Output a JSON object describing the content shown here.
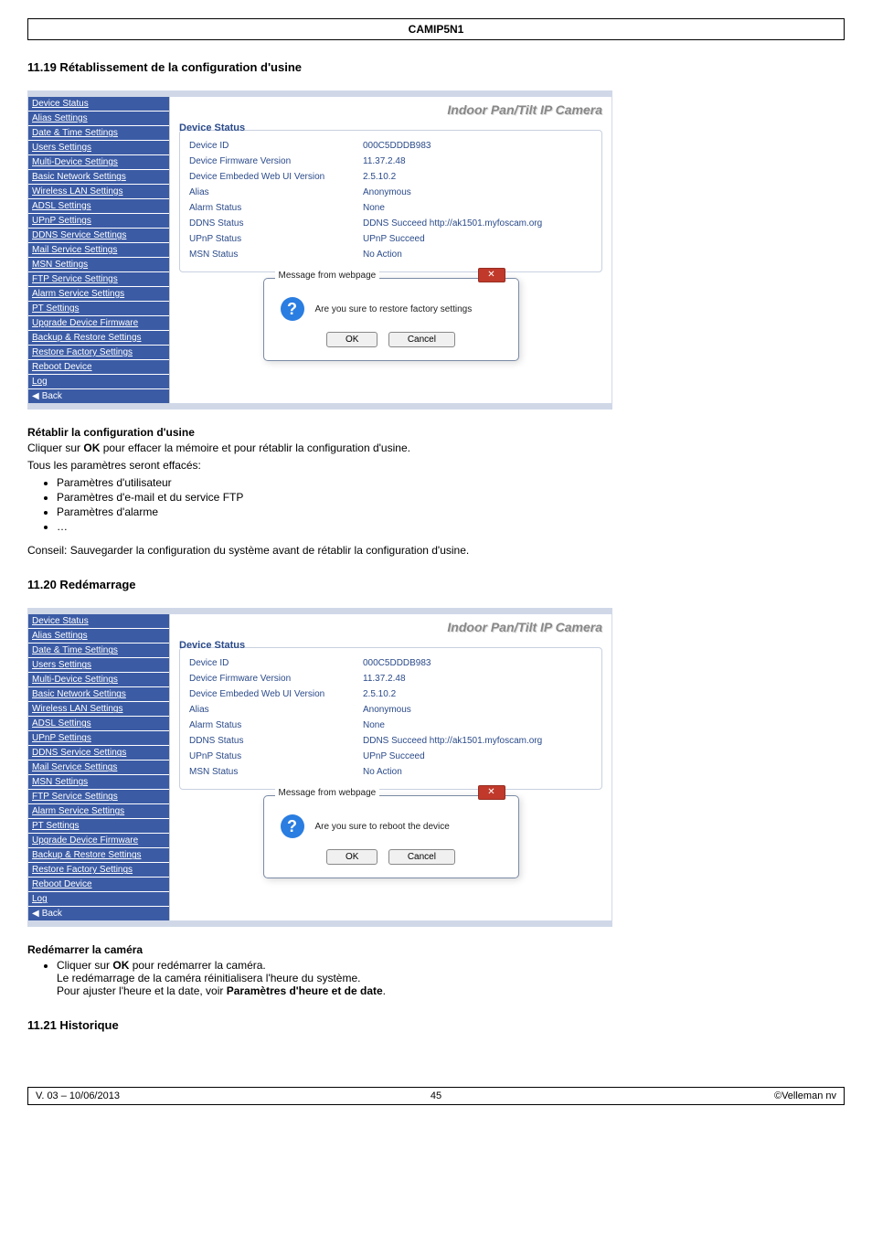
{
  "page": {
    "header": "CAMIP5N1",
    "footer_left": "V. 03 – 10/06/2013",
    "footer_center": "45",
    "footer_right": "©Velleman nv"
  },
  "sections": {
    "s1_title": "11.19 Rétablissement de la configuration d'usine",
    "s2_title": "11.20 Redémarrage",
    "s3_title": "11.21 Historique"
  },
  "sidebar": {
    "items": [
      "Device Status",
      "Alias Settings",
      "Date & Time Settings",
      "Users Settings",
      "Multi-Device Settings",
      "Basic Network Settings",
      "Wireless LAN Settings",
      "ADSL Settings",
      "UPnP Settings",
      "DDNS Service Settings",
      "Mail Service Settings",
      "MSN Settings",
      "FTP Service Settings",
      "Alarm Service Settings",
      "PT Settings",
      "Upgrade Device Firmware",
      "Backup & Restore Settings",
      "Restore Factory Settings",
      "Reboot Device",
      "Log"
    ],
    "back": "Back"
  },
  "main": {
    "title": "Indoor Pan/Tilt IP Camera",
    "fieldset_label": "Device Status",
    "rows": [
      {
        "k": "Device ID",
        "v": "000C5DDDB983"
      },
      {
        "k": "Device Firmware Version",
        "v": "11.37.2.48"
      },
      {
        "k": "Device Embeded Web UI Version",
        "v": "2.5.10.2"
      },
      {
        "k": "Alias",
        "v": "Anonymous"
      },
      {
        "k": "Alarm Status",
        "v": "None"
      },
      {
        "k": "DDNS Status",
        "v": "DDNS Succeed  http://ak1501.myfoscam.org"
      },
      {
        "k": "UPnP Status",
        "v": "UPnP Succeed"
      },
      {
        "k": "MSN Status",
        "v": "No Action"
      }
    ]
  },
  "dialog1": {
    "title": "Message from webpage",
    "close": "✕",
    "q": "?",
    "msg": "Are you sure to restore factory settings",
    "ok": "OK",
    "cancel": "Cancel"
  },
  "dialog2": {
    "title": "Message from webpage",
    "close": "✕",
    "q": "?",
    "msg": "Are you sure to reboot the device",
    "ok": "OK",
    "cancel": "Cancel"
  },
  "text": {
    "t1_h": "Rétablir la configuration d'usine",
    "t1_p1": "Cliquer sur OK pour effacer la mémoire et pour rétablir la configuration d'usine.",
    "t1_p2": "Tous les paramètres seront effacés:",
    "t1_b1": "Paramètres d'utilisateur",
    "t1_b2": "Paramètres d'e-mail et du service FTP",
    "t1_b3": "Paramètres d'alarme",
    "t1_b4": "…",
    "t1_p3": "Conseil: Sauvegarder la configuration du système avant de rétablir la configuration d'usine.",
    "t2_h": "Redémarrer la caméra",
    "t2_b1a": "Cliquer sur ",
    "t2_b1b": "OK",
    "t2_b1c": " pour redémarrer la caméra.",
    "t2_p2": "Le redémarrage de la caméra réinitialisera l'heure du système.",
    "t2_p3a": "Pour ajuster l'heure et la date, voir ",
    "t2_p3b": "Paramètres d'heure et de date",
    "t2_p3c": "."
  }
}
